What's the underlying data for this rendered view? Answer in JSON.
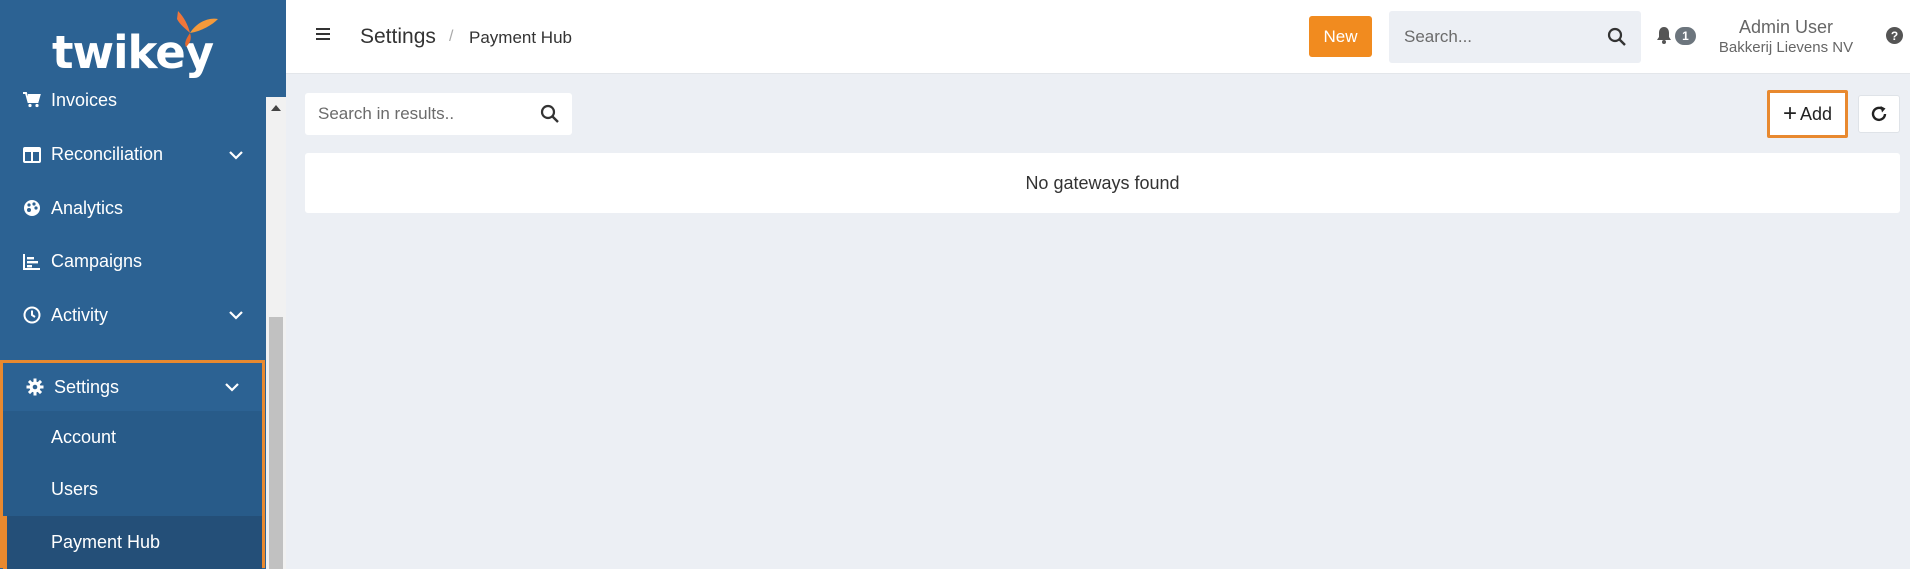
{
  "brand": {
    "logo_text": "twikey",
    "accent": "#f18b1f",
    "sidebar_bg": "#2c6293"
  },
  "sidebar": {
    "items": [
      {
        "label": "Invoices",
        "icon": "cart-icon",
        "expandable": false
      },
      {
        "label": "Reconciliation",
        "icon": "table-icon",
        "expandable": true
      },
      {
        "label": "Analytics",
        "icon": "palette-icon",
        "expandable": false
      },
      {
        "label": "Campaigns",
        "icon": "bar-chart-icon",
        "expandable": false
      },
      {
        "label": "Activity",
        "icon": "clock-icon",
        "expandable": true
      }
    ],
    "settings": {
      "label": "Settings",
      "icon": "gear-icon",
      "children": [
        {
          "label": "Account"
        },
        {
          "label": "Users"
        },
        {
          "label": "Payment Hub",
          "active": true
        }
      ]
    }
  },
  "header": {
    "breadcrumb": {
      "main": "Settings",
      "separator": "/",
      "sub": "Payment Hub"
    },
    "new_label": "New",
    "search_placeholder": "Search...",
    "notification_count": "1",
    "user_name": "Admin User",
    "user_org": "Bakkerij Lievens NV",
    "help_glyph": "?"
  },
  "main": {
    "results_search_placeholder": "Search in results..",
    "add_label": "Add",
    "empty_message": "No gateways found"
  }
}
